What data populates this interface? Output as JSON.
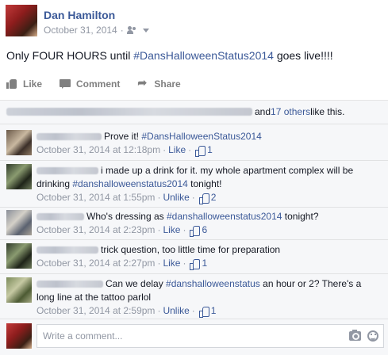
{
  "post": {
    "author": "Dan Hamilton",
    "date": "October 31, 2014",
    "separator": "·",
    "audience_icon": "friends-icon",
    "text_before": "Only FOUR HOURS until ",
    "text_hashtag": "#DansHalloweenStatus2014",
    "text_after": " goes live!!!!"
  },
  "actions": {
    "like_label": "Like",
    "comment_label": "Comment",
    "share_label": "Share"
  },
  "likes": {
    "and_text": "and ",
    "others_link": "17 others",
    "suffix": " like this."
  },
  "comments": [
    {
      "text_before": "Prove it! ",
      "hashtag": "#DansHalloweenStatus2014",
      "text_after": "",
      "time": "October 31, 2014 at 12:18pm",
      "action": "Like",
      "likes": "1"
    },
    {
      "text_before": "i made up a drink for it. my whole apartment complex will be drinking ",
      "hashtag": "#danshalloweenstatus2014",
      "text_after": " tonight!",
      "time": "October 31, 2014 at 1:55pm",
      "action": "Unlike",
      "likes": "2"
    },
    {
      "text_before": "Who's dressing as ",
      "hashtag": "#danshalloweenstatus2014",
      "text_after": " tonight?",
      "time": "October 31, 2014 at 2:23pm",
      "action": "Like",
      "likes": "6"
    },
    {
      "text_before": "trick question, too little time for preparation",
      "hashtag": "",
      "text_after": "",
      "time": "October 31, 2014 at 2:27pm",
      "action": "Like",
      "likes": "1"
    },
    {
      "text_before": "Can we delay ",
      "hashtag": "#danshalloweenstatus",
      "text_after": " an hour or 2? There's a long line at the tattoo parlol",
      "time": "October 31, 2014 at 2:59pm",
      "action": "Unlike",
      "likes": "1"
    }
  ],
  "write_comment": {
    "placeholder": "Write a comment..."
  },
  "colors": {
    "link": "#3b5998",
    "meta": "#9197a3",
    "feedback_bg": "#f6f7f9"
  }
}
